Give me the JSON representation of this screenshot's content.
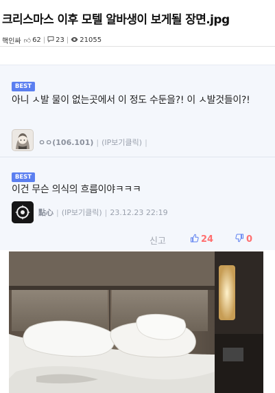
{
  "post": {
    "title": "크리스마스 이후 모텔 알바생이 보게될 장면.jpg",
    "author": "핵인싸",
    "likes": "62",
    "comments": "23",
    "views": "21055"
  },
  "comments": [
    {
      "badge": "BEST",
      "text": "아니 ㅅ발 물이 없는곳에서 이 정도 수둔을?! 이 ㅅ발것들이?!",
      "nickname": "ㅇㅇ(106.101)",
      "ip_link": "(IP보기클릭)",
      "trail": "|"
    },
    {
      "badge": "BEST",
      "text": "이건 무슨 의식의 흐름이야ㅋㅋㅋ",
      "nickname": "點心",
      "ip_link": "(IP보기클릭)",
      "datetime": "23.12.23 22:19",
      "report_label": "신고",
      "likes": "24",
      "dislikes": "0"
    }
  ],
  "colors": {
    "accent": "#5b7ff0",
    "vote": "#ff6f6f",
    "comment_bg": "#f4f7fc"
  },
  "icons": [
    "thumbs-up-icon",
    "speech-bubble-icon",
    "eye-icon",
    "thumbs-down-icon"
  ]
}
